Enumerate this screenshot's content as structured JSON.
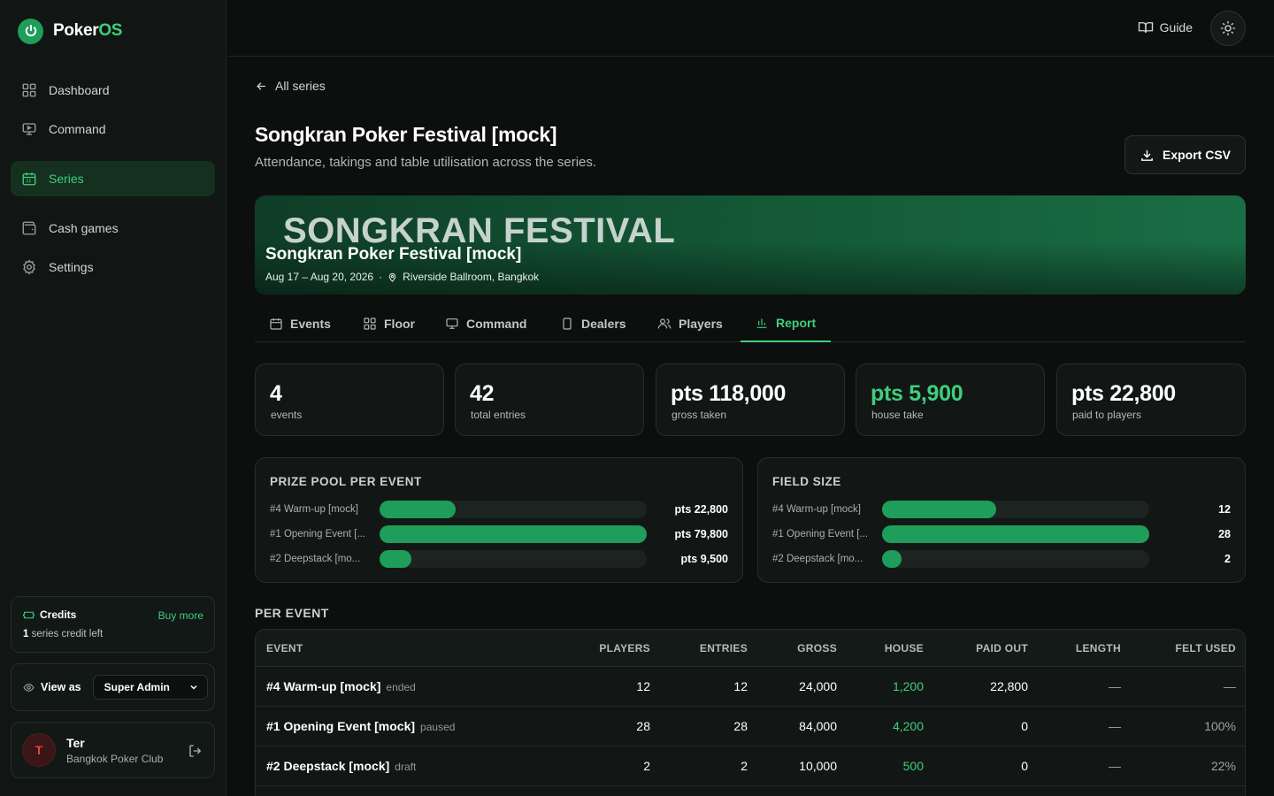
{
  "app": {
    "name_prefix": "Poker",
    "name_suffix": "OS"
  },
  "sidebar": {
    "items": [
      {
        "label": "Dashboard",
        "icon": "grid-icon"
      },
      {
        "label": "Command",
        "icon": "monitor-icon"
      },
      {
        "label": "Series",
        "icon": "calendar-icon",
        "active": true
      },
      {
        "label": "Cash games",
        "icon": "wallet-icon"
      },
      {
        "label": "Settings",
        "icon": "gear-icon"
      }
    ],
    "credits": {
      "title": "Credits",
      "buy": "Buy more",
      "count": "1",
      "left_text": "series credit left"
    },
    "view_as": {
      "label": "View as",
      "value": "Super Admin"
    },
    "user": {
      "initial": "T",
      "name": "Ter",
      "club": "Bangkok Poker Club"
    }
  },
  "topbar": {
    "guide": "Guide"
  },
  "page": {
    "back": "All series",
    "title": "Songkran Poker Festival [mock]",
    "subtitle": "Attendance, takings and table utilisation across the series.",
    "export": "Export CSV"
  },
  "banner": {
    "big": "SONGKRAN FESTIVAL",
    "name": "Songkran Poker Festival [mock]",
    "dates": "Aug 17 – Aug 20, 2026",
    "venue": "Riverside Ballroom, Bangkok"
  },
  "tabs": [
    "Events",
    "Floor",
    "Command",
    "Dealers",
    "Players",
    "Report"
  ],
  "stats": [
    {
      "value": "4",
      "label": "events"
    },
    {
      "value": "42",
      "label": "total entries"
    },
    {
      "value": "pts 118,000",
      "label": "gross taken"
    },
    {
      "value": "pts 5,900",
      "label": "house take",
      "accent": true
    },
    {
      "value": "pts 22,800",
      "label": "paid to players"
    }
  ],
  "chart_data": [
    {
      "type": "bar",
      "title": "PRIZE POOL PER EVENT",
      "categories": [
        "#4 Warm-up [mock]",
        "#1 Opening Event [...",
        "#2 Deepstack [mo..."
      ],
      "values": [
        22800,
        79800,
        9500
      ],
      "labels": [
        "pts 22,800",
        "pts 79,800",
        "pts 9,500"
      ],
      "xlim": [
        0,
        79800
      ]
    },
    {
      "type": "bar",
      "title": "FIELD SIZE",
      "categories": [
        "#4 Warm-up [mock]",
        "#1 Opening Event [...",
        "#2 Deepstack [mo..."
      ],
      "values": [
        12,
        28,
        2
      ],
      "labels": [
        "12",
        "28",
        "2"
      ],
      "xlim": [
        0,
        28
      ]
    }
  ],
  "per_event": {
    "title": "PER EVENT",
    "columns": [
      "EVENT",
      "PLAYERS",
      "ENTRIES",
      "GROSS",
      "HOUSE",
      "PAID OUT",
      "LENGTH",
      "FELT USED"
    ],
    "rows": [
      {
        "event": "#4 Warm-up [mock]",
        "status": "ended",
        "players": "12",
        "entries": "12",
        "gross": "24,000",
        "house": "1,200",
        "paid": "22,800",
        "length": "—",
        "felt": "—"
      },
      {
        "event": "#1 Opening Event [mock]",
        "status": "paused",
        "players": "28",
        "entries": "28",
        "gross": "84,000",
        "house": "4,200",
        "paid": "0",
        "length": "—",
        "felt": "100%"
      },
      {
        "event": "#2 Deepstack [mock]",
        "status": "draft",
        "players": "2",
        "entries": "2",
        "gross": "10,000",
        "house": "500",
        "paid": "0",
        "length": "—",
        "felt": "22%"
      }
    ]
  },
  "colors": {
    "accent": "#3ecf7d",
    "bar": "#1f9d5a",
    "background": "#0d0f0e"
  }
}
